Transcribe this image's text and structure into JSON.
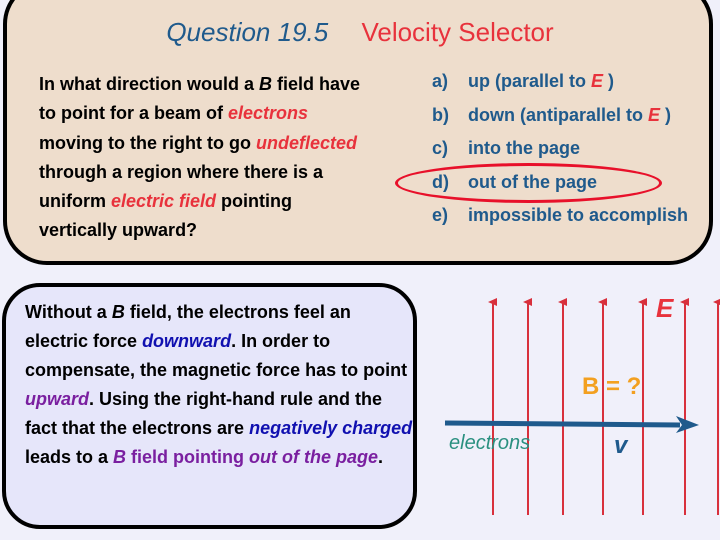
{
  "slide": {
    "title": {
      "number": "Question 19.5",
      "topic": "Velocity Selector"
    },
    "question": {
      "parts": [
        {
          "text": "In what direction would a ",
          "style": "plain"
        },
        {
          "text": "B",
          "style": "italic"
        },
        {
          "text": " field have to point for a beam of ",
          "style": "plain"
        },
        {
          "text": "electrons",
          "style": "red-italic"
        },
        {
          "text": " moving to the right to go ",
          "style": "plain"
        },
        {
          "text": "undeflected",
          "style": "red-italic"
        },
        {
          "text": " through a region where there is a uniform ",
          "style": "plain"
        },
        {
          "text": "electric field",
          "style": "red-italic"
        },
        {
          "text": " pointing vertically upward?",
          "style": "plain"
        }
      ]
    },
    "answers": [
      {
        "letter": "a)",
        "text": "up (parallel to ",
        "symbol": "E",
        "suffix": " )"
      },
      {
        "letter": "b)",
        "text": "down (antiparallel to ",
        "symbol": "E",
        "suffix": " )"
      },
      {
        "letter": "c)",
        "text": "into the page",
        "symbol": "",
        "suffix": ""
      },
      {
        "letter": "d)",
        "text": "out of the page",
        "symbol": "",
        "suffix": ""
      },
      {
        "letter": "e)",
        "text": "impossible to accomplish",
        "symbol": "",
        "suffix": ""
      }
    ],
    "correct_answer": "d)",
    "explanation": {
      "parts": [
        {
          "text": "Without a ",
          "style": "plain"
        },
        {
          "text": "B",
          "style": "italic"
        },
        {
          "text": " field, the electrons feel an electric force ",
          "style": "plain"
        },
        {
          "text": "downward",
          "style": "blue-italic"
        },
        {
          "text": ".  In order to compensate, the magnetic force has to point ",
          "style": "plain"
        },
        {
          "text": "upward",
          "style": "purple-italic"
        },
        {
          "text": ".   Using the right-hand rule and the fact that the electrons are ",
          "style": "plain"
        },
        {
          "text": "negatively charged",
          "style": "blue-italic"
        },
        {
          "text": " leads to a ",
          "style": "plain"
        },
        {
          "text": "B",
          "style": "purple-italic"
        },
        {
          "text": " field pointing ",
          "style": "purple"
        },
        {
          "text": "out of the page",
          "style": "purple-italic"
        },
        {
          "text": ".",
          "style": "plain"
        }
      ]
    },
    "diagram": {
      "E_label": "E",
      "B_label": "B = ?",
      "particle_label": "electrons",
      "velocity_label": "v",
      "field_line_count": 7,
      "colors": {
        "field_lines": "#D8303C",
        "velocity_arrow": "#1F5A8C"
      }
    }
  }
}
